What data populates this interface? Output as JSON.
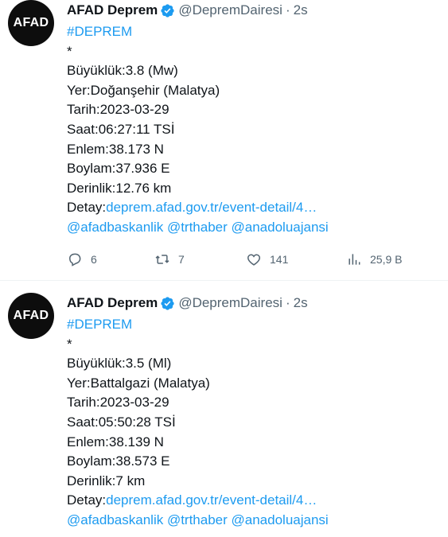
{
  "tweets": [
    {
      "avatar_text": "AFAD",
      "name": "AFAD Deprem",
      "handle": "@DepremDairesi",
      "separator": "·",
      "time": "2s",
      "hashtag": "#DEPREM",
      "star": "*",
      "magnitude": "Büyüklük:3.8 (Mw)",
      "location": "Yer:Doğanşehir (Malatya)",
      "date": "Tarih:2023-03-29",
      "hour": "Saat:06:27:11 TSİ",
      "lat": "Enlem:38.173 N",
      "lon": "Boylam:37.936 E",
      "depth": "Derinlik:12.76 km",
      "detail_label": "Detay:",
      "detail_link": "deprem.afad.gov.tr/event-detail/4…",
      "mentions": "@afadbaskanlik @trthaber @anadoluajansi",
      "reply_count": "6",
      "retweet_count": "7",
      "like_count": "141",
      "view_count": "25,9 B"
    },
    {
      "avatar_text": "AFAD",
      "name": "AFAD Deprem",
      "handle": "@DepremDairesi",
      "separator": "·",
      "time": "2s",
      "hashtag": "#DEPREM",
      "star": "*",
      "magnitude": "Büyüklük:3.5 (Ml)",
      "location": "Yer:Battalgazi (Malatya)",
      "date": "Tarih:2023-03-29",
      "hour": "Saat:05:50:28 TSİ",
      "lat": "Enlem:38.139 N",
      "lon": "Boylam:38.573 E",
      "depth": "Derinlik:7 km",
      "detail_label": "Detay:",
      "detail_link": "deprem.afad.gov.tr/event-detail/4…",
      "mentions": "@afadbaskanlik @trthaber @anadoluajansi"
    }
  ],
  "icons": {
    "verified": "verified-badge-icon",
    "reply": "reply-icon",
    "retweet": "retweet-icon",
    "like": "heart-icon",
    "views": "views-chart-icon"
  },
  "colors": {
    "link": "#1d9bf0",
    "secondary_text": "#536471",
    "avatar_bg": "#0d0d0d",
    "divider": "#eff3f4"
  }
}
